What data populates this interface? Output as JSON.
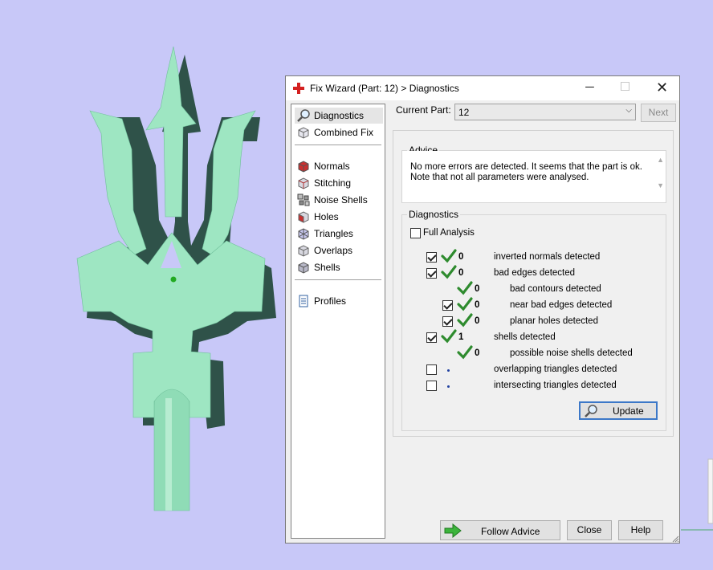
{
  "window": {
    "title": "Fix Wizard (Part: 12) > Diagnostics",
    "minimize_symbol": "─",
    "maximize_symbol": "☐",
    "close_symbol": "✕"
  },
  "nav": {
    "items": [
      {
        "label": "Diagnostics",
        "icon": "magnifier-icon"
      },
      {
        "label": "Combined Fix",
        "icon": "cube-icon"
      },
      {
        "label": "Normals",
        "icon": "cube-red-icon"
      },
      {
        "label": "Stitching",
        "icon": "stitching-icon"
      },
      {
        "label": "Noise Shells",
        "icon": "noise-shells-icon"
      },
      {
        "label": "Holes",
        "icon": "holes-icon"
      },
      {
        "label": "Triangles",
        "icon": "triangles-icon"
      },
      {
        "label": "Overlaps",
        "icon": "overlaps-icon"
      },
      {
        "label": "Shells",
        "icon": "shells-icon"
      },
      {
        "label": "Profiles",
        "icon": "profile-icon"
      }
    ]
  },
  "header": {
    "current_part_label": "Current Part:",
    "current_part_value": "12",
    "next_label": "Next"
  },
  "advice": {
    "title": "Advice",
    "text": "No more errors are detected. It seems that the part is ok.\nNote that not all parameters were analysed."
  },
  "diagnostics": {
    "title": "Diagnostics",
    "full_analysis_label": "Full Analysis",
    "full_analysis_checked": false,
    "rows": [
      {
        "checkbox": true,
        "checked": true,
        "status": "ok",
        "count": "0",
        "label": "inverted normals detected",
        "indent": 0
      },
      {
        "checkbox": true,
        "checked": true,
        "status": "ok",
        "count": "0",
        "label": "bad edges detected",
        "indent": 0
      },
      {
        "checkbox": false,
        "checked": false,
        "status": "ok",
        "count": "0",
        "label": "bad contours detected",
        "indent": 1
      },
      {
        "checkbox": true,
        "checked": true,
        "status": "ok",
        "count": "0",
        "label": "near bad edges detected",
        "indent": 1
      },
      {
        "checkbox": true,
        "checked": true,
        "status": "ok",
        "count": "0",
        "label": "planar holes detected",
        "indent": 1
      },
      {
        "checkbox": true,
        "checked": true,
        "status": "ok",
        "count": "1",
        "label": "shells detected",
        "indent": 0
      },
      {
        "checkbox": false,
        "checked": false,
        "status": "ok",
        "count": "0",
        "label": "possible noise shells detected",
        "indent": 1
      },
      {
        "checkbox": true,
        "checked": false,
        "status": "none",
        "count": "",
        "label": "overlapping triangles detected",
        "indent": 0
      },
      {
        "checkbox": true,
        "checked": false,
        "status": "none",
        "count": "",
        "label": "intersecting triangles detected",
        "indent": 0
      }
    ],
    "update_label": "Update"
  },
  "footer": {
    "follow_advice_label": "Follow Advice",
    "close_label": "Close",
    "help_label": "Help"
  },
  "colors": {
    "viewport_bg": "#c8c8f8",
    "model_fill": "#9ee6c2",
    "model_shadow": "#2f5249",
    "check_green": "#2e8b2e",
    "accent_red": "#d42020"
  }
}
